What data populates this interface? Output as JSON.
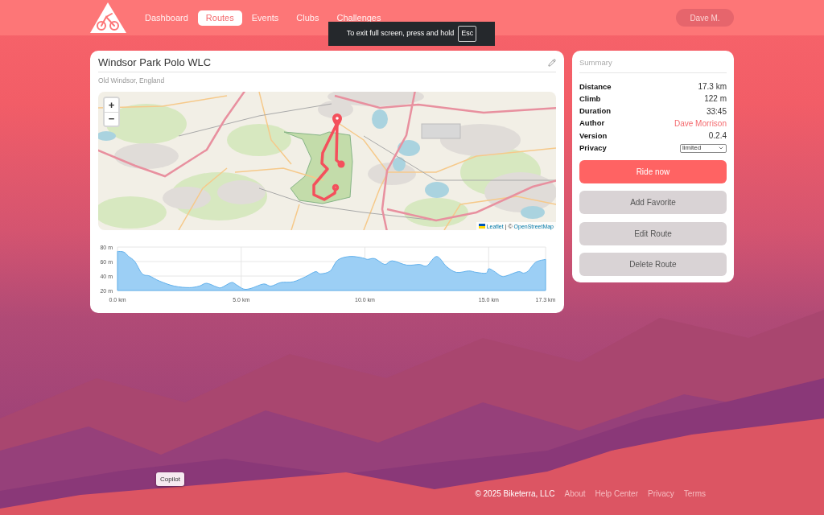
{
  "header": {
    "nav": [
      {
        "label": "Dashboard",
        "selected": false
      },
      {
        "label": "Routes",
        "selected": true
      },
      {
        "label": "Events",
        "selected": false
      },
      {
        "label": "Clubs",
        "selected": false
      },
      {
        "label": "Challenges",
        "selected": false
      }
    ],
    "user_button": "Dave M."
  },
  "fullscreen_notice": {
    "text": "To exit full screen, press and hold",
    "key": "Esc"
  },
  "route": {
    "title": "Windsor Park Polo WLC",
    "location": "Old Windsor, England",
    "map": {
      "zoom_controls": [
        "+",
        "−"
      ],
      "attribution": {
        "links": [
          "Leaflet",
          "OpenStreetMap"
        ],
        "separator": "| ©"
      }
    },
    "elevation": {
      "chart_data": {
        "type": "area",
        "grid": true,
        "x": [
          0,
          0.26,
          0.45,
          0.7,
          1.0,
          1.3,
          1.7,
          2.3,
          2.9,
          3.3,
          3.6,
          4.0,
          4.2,
          4.6,
          4.8,
          5.1,
          5.4,
          5.9,
          6.2,
          6.6,
          7.1,
          7.6,
          8.0,
          8.2,
          8.6,
          8.9,
          9.4,
          9.9,
          10.1,
          10.4,
          10.8,
          11.1,
          11.7,
          12.2,
          12.5,
          12.9,
          13.3,
          13.7,
          14.2,
          14.5,
          14.9,
          15.0,
          15.2,
          15.5,
          15.7,
          16.2,
          16.4,
          16.6,
          16.9,
          17.3
        ],
        "series": [
          {
            "color": "#9ccff5",
            "values": [
              74,
              73,
              67,
              60,
              43,
              40,
              33,
              26,
              24,
              26,
              30,
              25,
              24,
              31,
              28,
              22,
              23,
              29,
              26,
              31,
              32,
              39,
              46,
              43,
              47,
              62,
              67,
              65,
              63,
              64,
              56,
              61,
              55,
              56,
              54,
              67,
              53,
              45,
              47,
              45,
              44,
              50,
              47,
              40,
              40,
              46,
              44,
              47,
              59,
              63
            ]
          }
        ],
        "xlim": [
          0,
          17.3
        ],
        "ylim": [
          20,
          80
        ],
        "xticks": [
          {
            "value": 0,
            "label": "0.0 km"
          },
          {
            "value": 5,
            "label": "5.0 km"
          },
          {
            "value": 10,
            "label": "10.0 km"
          },
          {
            "value": 15,
            "label": "15.0 km"
          },
          {
            "value": 17.3,
            "label": "17.3 km"
          }
        ],
        "yticks": [
          {
            "value": 20,
            "label": "20 m"
          },
          {
            "value": 40,
            "label": "40 m"
          },
          {
            "value": 60,
            "label": "60 m"
          },
          {
            "value": 80,
            "label": "80 m"
          }
        ]
      }
    }
  },
  "summary": {
    "title": "Summary",
    "rows": [
      {
        "label": "Distance",
        "value": "17.3 km",
        "kind": "text"
      },
      {
        "label": "Climb",
        "value": "122 m",
        "kind": "text"
      },
      {
        "label": "Duration",
        "value": "33:45",
        "kind": "text"
      },
      {
        "label": "Author",
        "value": "Dave Morrison",
        "kind": "link"
      },
      {
        "label": "Version",
        "value": "0.2.4",
        "kind": "text"
      },
      {
        "label": "Privacy",
        "value": "limited",
        "kind": "select"
      }
    ],
    "actions": [
      {
        "label": "Ride now",
        "kind": "primary"
      },
      {
        "label": "Add Favorite",
        "kind": "secondary"
      },
      {
        "label": "Edit Route",
        "kind": "secondary"
      },
      {
        "label": "Delete Route",
        "kind": "secondary"
      }
    ]
  },
  "copilot_button": "Copilot",
  "footer": {
    "copyright": "© 2025 Biketerra, LLC",
    "links": [
      "About",
      "Help Center",
      "Privacy",
      "Terms"
    ]
  }
}
